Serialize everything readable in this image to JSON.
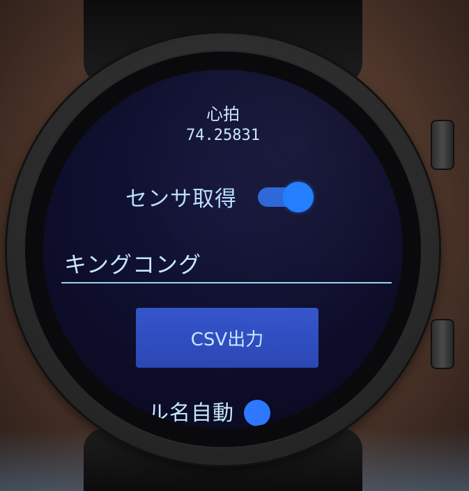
{
  "app": {
    "heart_rate_label": "心拍",
    "heart_rate_value": "74.25831",
    "sensor_toggle": {
      "label": "センサ取得",
      "state": "on"
    },
    "name_field": {
      "value": "キングコング",
      "placeholder": ""
    },
    "csv_button_label": "CSV出力",
    "auto_name_toggle": {
      "label": "ル名自動",
      "state": "on"
    }
  },
  "colors": {
    "screen_bg": "#0e0e2c",
    "text": "#c8e8ff",
    "accent": "#1e7bff",
    "button_bg": "#3050c0",
    "underline": "#9ad4f0"
  }
}
